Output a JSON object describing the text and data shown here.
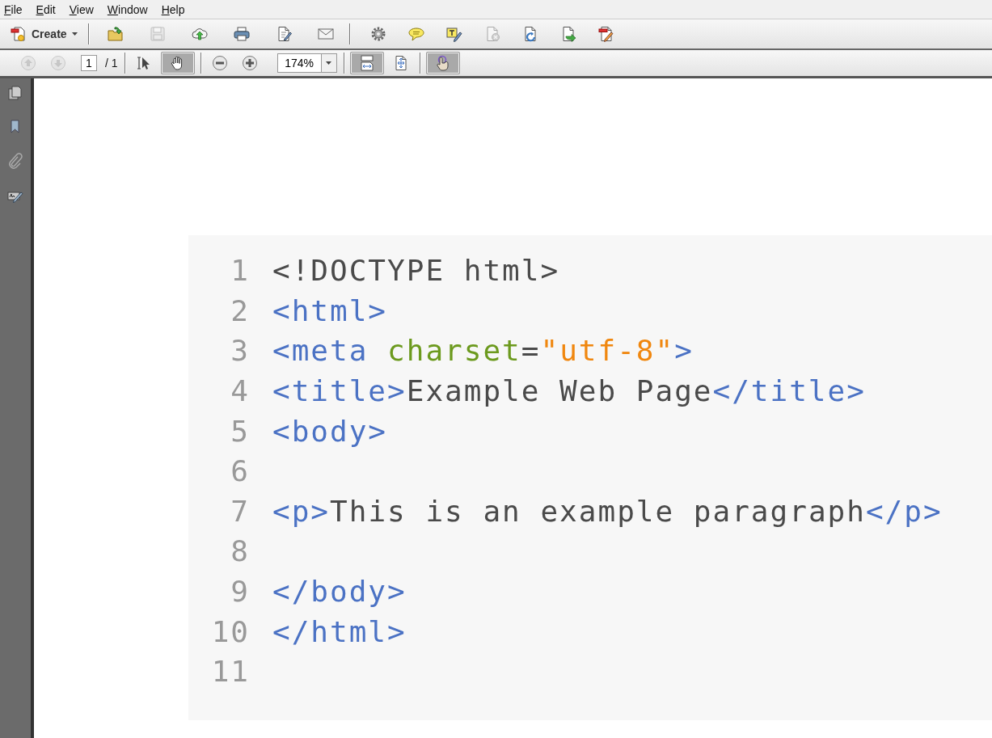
{
  "menu": [
    {
      "label": "File"
    },
    {
      "label": "Edit"
    },
    {
      "label": "View"
    },
    {
      "label": "Window"
    },
    {
      "label": "Help"
    }
  ],
  "toolbar": {
    "create": {
      "label": "Create"
    },
    "groups": [
      [
        {
          "disabled": false
        },
        {
          "disabled": true
        },
        {
          "disabled": false
        },
        {
          "disabled": false
        },
        {
          "disabled": false
        },
        {
          "disabled": false
        }
      ],
      [
        {
          "disabled": false
        },
        {
          "disabled": false
        },
        {
          "disabled": false
        },
        {
          "disabled": true
        },
        {
          "disabled": false
        },
        {
          "disabled": false
        },
        {
          "disabled": false
        }
      ]
    ]
  },
  "nav_toolbar": {
    "groups": [
      [
        {
          "kind": "button",
          "disabled": true,
          "selected": false
        },
        {
          "kind": "button",
          "disabled": true,
          "selected": false
        },
        {
          "kind": "field",
          "value": "1"
        },
        {
          "kind": "label",
          "text": "/ 1"
        }
      ],
      [
        {
          "kind": "button",
          "disabled": false,
          "selected": false
        },
        {
          "kind": "button",
          "disabled": false,
          "selected": true
        }
      ],
      [
        {
          "kind": "button",
          "disabled": false,
          "selected": false
        },
        {
          "kind": "button",
          "disabled": false,
          "selected": false
        },
        {
          "kind": "combo",
          "value": "174%"
        }
      ],
      [
        {
          "kind": "button",
          "disabled": false,
          "selected": true
        },
        {
          "kind": "button",
          "disabled": false,
          "selected": false
        }
      ],
      [
        {
          "kind": "button",
          "disabled": false,
          "selected": true
        }
      ]
    ]
  },
  "code": {
    "lines": [
      {
        "number": "1",
        "tokens": [
          {
            "kind": "plain",
            "text": "<!DOCTYPE html>"
          }
        ]
      },
      {
        "number": "2",
        "tokens": [
          {
            "kind": "tag",
            "text": "<html>"
          }
        ]
      },
      {
        "number": "3",
        "tokens": [
          {
            "kind": "tag",
            "text": "<meta "
          },
          {
            "kind": "attr",
            "text": "charset"
          },
          {
            "kind": "plain",
            "text": "="
          },
          {
            "kind": "string",
            "text": "\"utf-8\""
          },
          {
            "kind": "tag",
            "text": ">"
          }
        ]
      },
      {
        "number": "4",
        "tokens": [
          {
            "kind": "tag",
            "text": "<title>"
          },
          {
            "kind": "plain",
            "text": "Example Web Page"
          },
          {
            "kind": "tag",
            "text": "</title>"
          }
        ]
      },
      {
        "number": "5",
        "tokens": [
          {
            "kind": "tag",
            "text": "<body>"
          }
        ]
      },
      {
        "number": "6"
      },
      {
        "number": "7",
        "tokens": [
          {
            "kind": "tag",
            "text": "<p>"
          },
          {
            "kind": "plain",
            "text": "This is an example paragraph"
          },
          {
            "kind": "tag",
            "text": "</p>"
          }
        ]
      },
      {
        "number": "8"
      },
      {
        "number": "9",
        "tokens": [
          {
            "kind": "tag",
            "text": "</body>"
          }
        ]
      },
      {
        "number": "10",
        "tokens": [
          {
            "kind": "tag",
            "text": "</html>"
          }
        ]
      },
      {
        "number": "11"
      }
    ]
  }
}
